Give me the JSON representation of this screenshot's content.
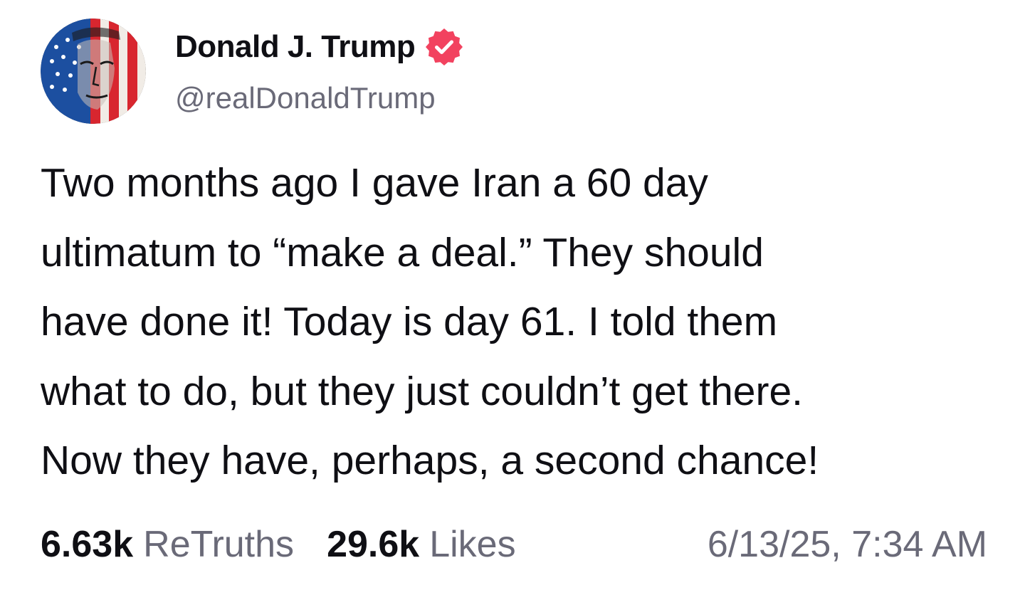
{
  "author": {
    "name": "Donald J. Trump",
    "handle": "@realDonaldTrump",
    "verified_icon": "verified-badge-icon",
    "verified_color": "#f2425f"
  },
  "post": {
    "lines": [
      "Two months ago I gave Iran a 60 day",
      "ultimatum to “make a deal.” They should",
      "have done it! Today is day 61. I told them",
      "what to do, but they just couldn’t get there.",
      "Now they have, perhaps, a second chance!"
    ]
  },
  "stats": {
    "retruths_count": "6.63k",
    "retruths_label": "ReTruths",
    "likes_count": "29.6k",
    "likes_label": "Likes",
    "timestamp": "6/13/25, 7:34 AM"
  },
  "colors": {
    "text": "#0f0f14",
    "secondary_text": "#6a6a78",
    "background": "#ffffff"
  }
}
